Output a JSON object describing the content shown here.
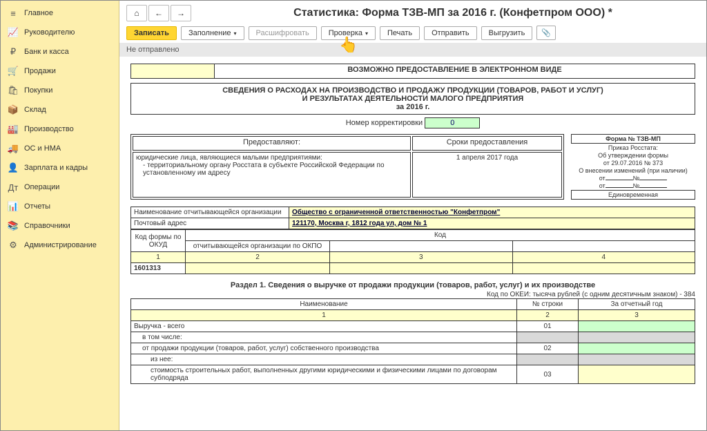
{
  "sidebar": [
    {
      "icon": "≡",
      "label": "Главное"
    },
    {
      "icon": "📈",
      "label": "Руководителю"
    },
    {
      "icon": "₽",
      "label": "Банк и касса"
    },
    {
      "icon": "🛒",
      "label": "Продажи"
    },
    {
      "icon": "🛍",
      "label": "Покупки"
    },
    {
      "icon": "📦",
      "label": "Склад"
    },
    {
      "icon": "🏭",
      "label": "Производство"
    },
    {
      "icon": "🚚",
      "label": "ОС и НМА"
    },
    {
      "icon": "👤",
      "label": "Зарплата и кадры"
    },
    {
      "icon": "Дт",
      "label": "Операции"
    },
    {
      "icon": "📊",
      "label": "Отчеты"
    },
    {
      "icon": "📚",
      "label": "Справочники"
    },
    {
      "icon": "⚙",
      "label": "Администрирование"
    }
  ],
  "nav": {
    "home": "⌂",
    "back": "←",
    "fwd": "→"
  },
  "title": "Статистика: Форма ТЗВ-МП за 2016 г. (Конфетпром ООО) *",
  "toolbar": {
    "save": "Записать",
    "fill": "Заполнение",
    "decode": "Расшифровать",
    "check": "Проверка",
    "print": "Печать",
    "send": "Отправить",
    "upload": "Выгрузить",
    "attach": "📎"
  },
  "status": "Не отправлено",
  "doc": {
    "electronic": "ВОЗМОЖНО ПРЕДОСТАВЛЕНИЕ В ЭЛЕКТРОННОМ ВИДЕ",
    "mainhdr1": "СВЕДЕНИЯ О РАСХОДАХ НА ПРОИЗВОДСТВО И ПРОДАЖУ ПРОДУКЦИИ (ТОВАРОВ, РАБОТ И УСЛУГ)",
    "mainhdr2": "И РЕЗУЛЬТАТАХ ДЕЯТЕЛЬНОСТИ МАЛОГО ПРЕДПРИЯТИЯ",
    "year": "за 2016 г.",
    "korr_lbl": "Номер корректировки",
    "korr_val": "0",
    "pred_hd": "Предоставляют:",
    "srok_hd": "Сроки предоставления",
    "pred_txt1": "юридические лица, являющиеся малыми предприятиями:",
    "pred_txt2": "- территориальному органу Росстата в субъекте Российской Федерации по установленному им адресу",
    "srok_val": "1 апреля 2017 года",
    "form_no": "Форма № ТЗВ-МП",
    "prikaz": "Приказ Росстата:",
    "utv": "Об утверждении формы",
    "utv_date": "от 29.07.2016 № 373",
    "izm": "О внесении изменений (при наличии)",
    "ot": "от",
    "num": "№",
    "freq": "Единовременная",
    "org_lbl": "Наименование отчитывающейся организации",
    "org_val": "Общество с ограниченной ответственностью \"Конфетпром\"",
    "addr_lbl": "Почтовый адрес",
    "addr_val": "121170, Москва г, 1812 года ул, дом № 1",
    "kod": "Код",
    "okud_lbl": "Код формы по ОКУД",
    "okpo_lbl": "отчитывающейся организации по ОКПО",
    "c1": "1",
    "c2": "2",
    "c3": "3",
    "c4": "4",
    "okud_val": "1601313",
    "section1": "Раздел 1. Сведения о выручке от продажи продукции (товаров, работ, услуг) и их производстве",
    "okei": "Код по ОКЕИ: тысяча рублей (с одним десятичным знаком) - 384",
    "col_name": "Наименование",
    "col_line": "№ строки",
    "col_year": "За отчетный год",
    "r1": "Выручка - всего",
    "r1n": "01",
    "r2": "в том числе:",
    "r3": "от продажи продукции (товаров, работ, услуг) собственного производства",
    "r3n": "02",
    "r4": "из нее:",
    "r5": "стоимость строительных работ, выполненных другими юридическими и физическими лицами по договорам субподряда",
    "r5n": "03"
  }
}
